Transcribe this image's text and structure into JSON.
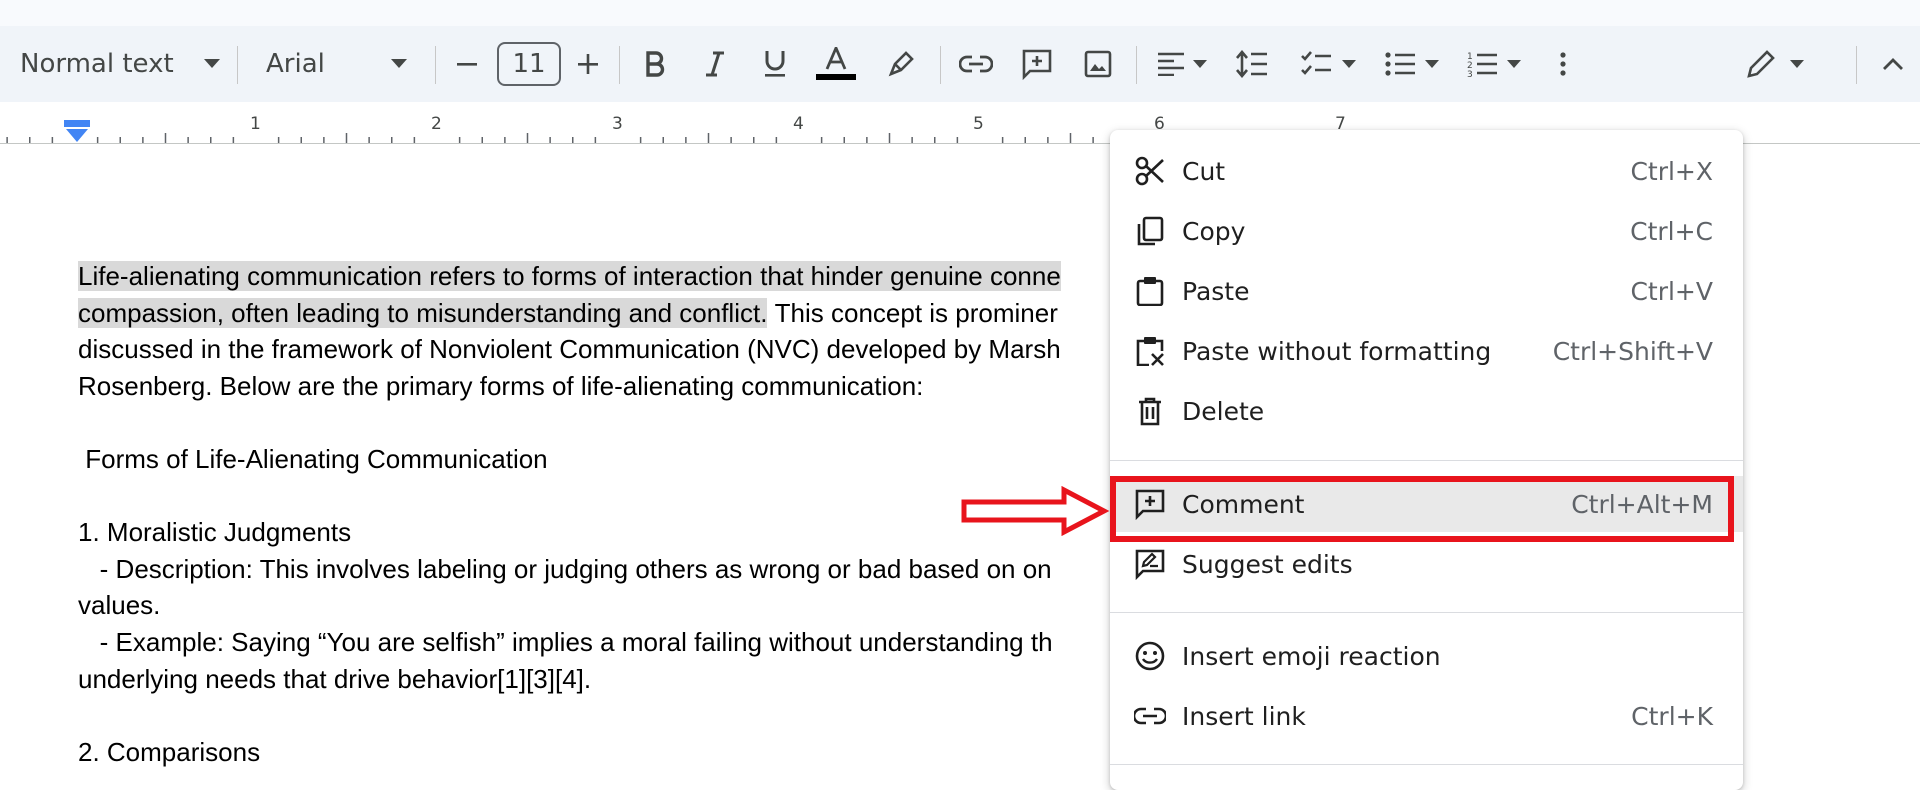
{
  "toolbar": {
    "style_select": "Normal text",
    "font_select": "Arial",
    "font_size": "11"
  },
  "ruler": {
    "numbers": [
      "1",
      "2",
      "3",
      "4",
      "5",
      "6",
      "7"
    ]
  },
  "document": {
    "lines": [
      {
        "highlight": "Life-alienating communication refers to forms of interaction that hinder genuine conne",
        "rest": ""
      },
      {
        "highlight": "compassion, often leading to misunderstanding and conflict.",
        "rest": " This concept is prominer"
      },
      {
        "highlight": "",
        "rest": "discussed in the framework of Nonviolent Communication (NVC) developed by Marsh"
      },
      {
        "highlight": "",
        "rest": "Rosenberg. Below are the primary forms of life-alienating communication:"
      },
      {
        "highlight": "",
        "rest": ""
      },
      {
        "highlight": "",
        "rest": " Forms of Life-Alienating Communication"
      },
      {
        "highlight": "",
        "rest": ""
      },
      {
        "highlight": "",
        "rest": "1. Moralistic Judgments"
      },
      {
        "highlight": "",
        "rest": "   - Description: This involves labeling or judging others as wrong or bad based on on"
      },
      {
        "highlight": "",
        "rest": "values."
      },
      {
        "highlight": "",
        "rest": "   - Example: Saying “You are selfish” implies a moral failing without understanding th"
      },
      {
        "highlight": "",
        "rest": "underlying needs that drive behavior[1][3][4]."
      },
      {
        "highlight": "",
        "rest": ""
      },
      {
        "highlight": "",
        "rest": "2. Comparisons"
      }
    ]
  },
  "context_menu": {
    "items": [
      {
        "label": "Cut",
        "shortcut": "Ctrl+X",
        "icon": "scissors-icon"
      },
      {
        "label": "Copy",
        "shortcut": "Ctrl+C",
        "icon": "copy-icon"
      },
      {
        "label": "Paste",
        "shortcut": "Ctrl+V",
        "icon": "clipboard-icon"
      },
      {
        "label": "Paste without formatting",
        "shortcut": "Ctrl+Shift+V",
        "icon": "clipboard-clear-icon"
      },
      {
        "label": "Delete",
        "shortcut": "",
        "icon": "trash-icon"
      },
      {
        "label": "Comment",
        "shortcut": "Ctrl+Alt+M",
        "icon": "add-comment-icon"
      },
      {
        "label": "Suggest edits",
        "shortcut": "",
        "icon": "suggest-edit-icon"
      },
      {
        "label": "Insert emoji reaction",
        "shortcut": "",
        "icon": "emoji-icon"
      },
      {
        "label": "Insert link",
        "shortcut": "Ctrl+K",
        "icon": "link-icon"
      }
    ]
  },
  "colors": {
    "annotation_red": "#e8141c",
    "toolbar_bg": "#f0f4f9",
    "selection_highlight": "#d9d9d9",
    "ruler_marker_blue": "#4285f4"
  }
}
